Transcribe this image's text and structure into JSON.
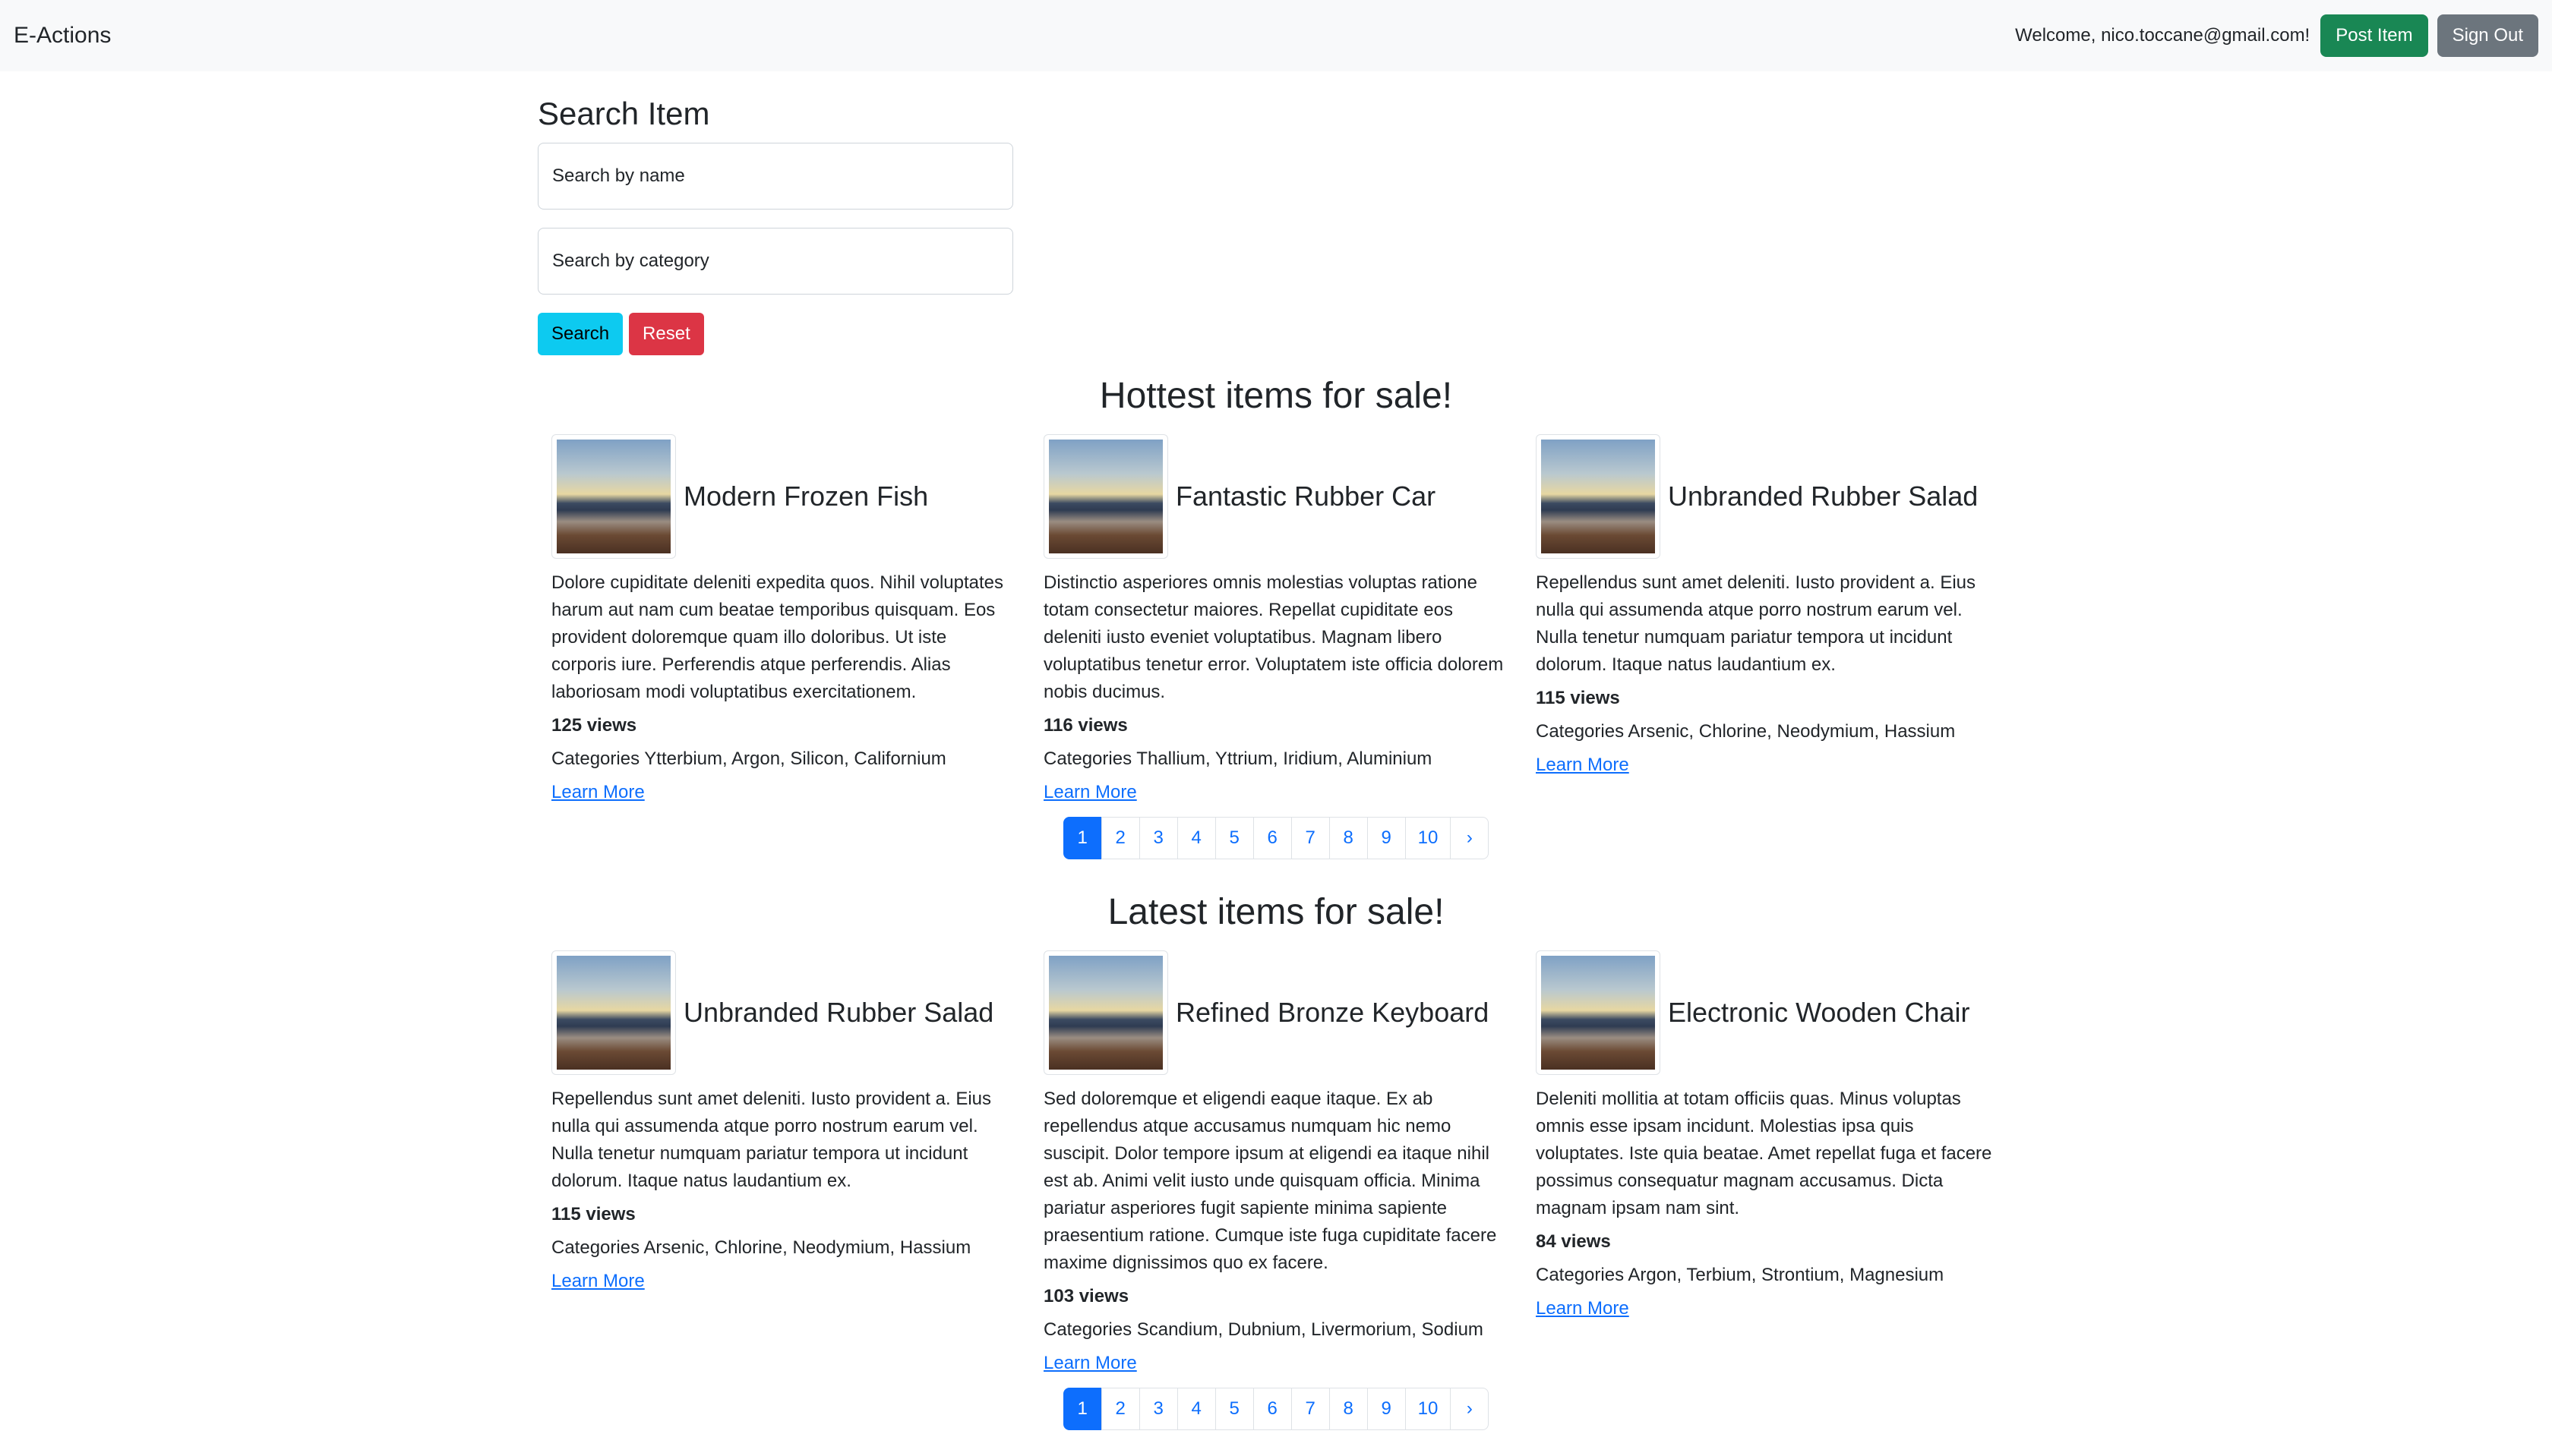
{
  "navbar": {
    "brand": "E-Actions",
    "welcome": "Welcome, nico.toccane@gmail.com!",
    "post_item": "Post Item",
    "sign_out": "Sign Out"
  },
  "search": {
    "title": "Search Item",
    "name_placeholder": "Search by name",
    "category_placeholder": "Search by category",
    "search_label": "Search",
    "reset_label": "Reset"
  },
  "hottest": {
    "title": "Hottest items for sale!",
    "items": [
      {
        "title": "Modern Frozen Fish",
        "description": "Dolore cupiditate deleniti expedita quos. Nihil voluptates harum aut nam cum beatae temporibus quisquam. Eos provident doloremque quam illo doloribus. Ut iste corporis iure. Perferendis atque perferendis. Alias laboriosam modi voluptatibus exercitationem.",
        "views": "125 views",
        "categories": "Categories Ytterbium, Argon, Silicon, Californium",
        "link": "Learn More"
      },
      {
        "title": "Fantastic Rubber Car",
        "description": "Distinctio asperiores omnis molestias voluptas ratione totam consectetur maiores. Repellat cupiditate eos deleniti iusto eveniet voluptatibus. Magnam libero voluptatibus tenetur error. Voluptatem iste officia dolorem nobis ducimus.",
        "views": "116 views",
        "categories": "Categories Thallium, Yttrium, Iridium, Aluminium",
        "link": "Learn More"
      },
      {
        "title": "Unbranded Rubber Salad",
        "description": "Repellendus sunt amet deleniti. Iusto provident a. Eius nulla qui assumenda atque porro nostrum earum vel. Nulla tenetur numquam pariatur tempora ut incidunt dolorum. Itaque natus laudantium ex.",
        "views": "115 views",
        "categories": "Categories Arsenic, Chlorine, Neodymium, Hassium",
        "link": "Learn More"
      }
    ]
  },
  "latest": {
    "title": "Latest items for sale!",
    "items": [
      {
        "title": "Unbranded Rubber Salad",
        "description": "Repellendus sunt amet deleniti. Iusto provident a. Eius nulla qui assumenda atque porro nostrum earum vel. Nulla tenetur numquam pariatur tempora ut incidunt dolorum. Itaque natus laudantium ex.",
        "views": "115 views",
        "categories": "Categories Arsenic, Chlorine, Neodymium, Hassium",
        "link": "Learn More"
      },
      {
        "title": "Refined Bronze Keyboard",
        "description": "Sed doloremque et eligendi eaque itaque. Ex ab repellendus atque accusamus numquam hic nemo suscipit. Dolor tempore ipsum at eligendi ea itaque nihil est ab. Animi velit iusto unde quisquam officia. Minima pariatur asperiores fugit sapiente minima sapiente praesentium ratione. Cumque iste fuga cupiditate facere maxime dignissimos quo ex facere.",
        "views": "103 views",
        "categories": "Categories Scandium, Dubnium, Livermorium, Sodium",
        "link": "Learn More"
      },
      {
        "title": "Electronic Wooden Chair",
        "description": "Deleniti mollitia at totam officiis quas. Minus voluptas omnis esse ipsam incidunt. Molestias ipsa quis voluptates. Iste quia beatae. Amet repellat fuga et facere possimus consequatur magnam accusamus. Dicta magnam ipsam nam sint.",
        "views": "84 views",
        "categories": "Categories Argon, Terbium, Strontium, Magnesium",
        "link": "Learn More"
      }
    ]
  },
  "pagination": {
    "pages": [
      "1",
      "2",
      "3",
      "4",
      "5",
      "6",
      "7",
      "8",
      "9",
      "10"
    ],
    "next": "›",
    "active_page": "1"
  },
  "colors": {
    "primary": "#0d6efd",
    "success": "#198754",
    "secondary": "#6c757d",
    "info": "#0dcaf0",
    "danger": "#dc3545",
    "navbar_bg": "#f8f9fa"
  }
}
